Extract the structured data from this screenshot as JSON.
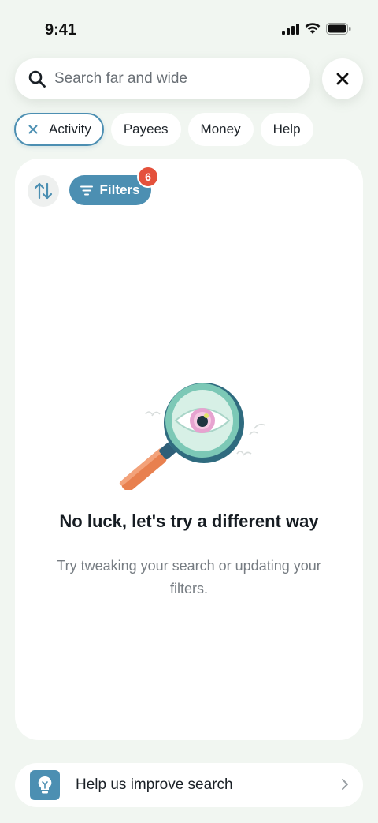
{
  "status_bar": {
    "time": "9:41"
  },
  "search": {
    "placeholder": "Search far and wide",
    "value": ""
  },
  "chips": [
    {
      "label": "Activity",
      "active": true
    },
    {
      "label": "Payees",
      "active": false
    },
    {
      "label": "Money",
      "active": false
    },
    {
      "label": "Help",
      "active": false
    }
  ],
  "toolbar": {
    "filters_label": "Filters",
    "filters_count": "6"
  },
  "empty_state": {
    "title": "No luck, let's try a different way",
    "subtitle": "Try tweaking your search or updating your filters."
  },
  "feedback": {
    "label": "Help us improve search"
  },
  "colors": {
    "accent": "#4c8fb2",
    "badge": "#e4513c",
    "background": "#f1f6f1"
  }
}
